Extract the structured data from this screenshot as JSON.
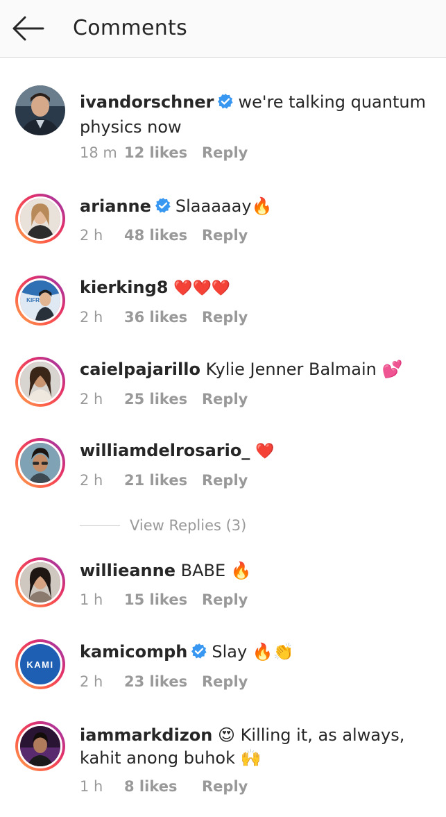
{
  "header": {
    "title": "Comments",
    "back_icon": "back-arrow-icon"
  },
  "comments": [
    {
      "username": "ivandorschner",
      "verified": true,
      "text": "we're talking quantum physics now",
      "time": "18 m",
      "likes": "12 likes",
      "reply": "Reply",
      "avatar_ring": false
    },
    {
      "username": "arianne",
      "verified": true,
      "text": "Slaaaaay🔥",
      "time": "2 h",
      "likes": "48 likes",
      "reply": "Reply",
      "avatar_ring": true
    },
    {
      "username": "kierking8",
      "verified": false,
      "text": "❤️❤️❤️",
      "time": "2 h",
      "likes": "36 likes",
      "reply": "Reply",
      "avatar_ring": true,
      "avatar_text": "KIFR"
    },
    {
      "username": "caielpajarillo",
      "verified": false,
      "text": "Kylie Jenner Balmain 💕",
      "time": "2 h",
      "likes": "25 likes",
      "reply": "Reply",
      "avatar_ring": true
    },
    {
      "username": "williamdelrosario_",
      "verified": false,
      "text": "❤️",
      "time": "2 h",
      "likes": "21 likes",
      "reply": "Reply",
      "avatar_ring": true
    },
    {
      "username": "willieanne",
      "verified": false,
      "text": "BABE 🔥",
      "time": "1 h",
      "likes": "15 likes",
      "reply": "Reply",
      "avatar_ring": true
    },
    {
      "username": "kamicomph",
      "verified": true,
      "text": "Slay 🔥👏",
      "time": "2 h",
      "likes": "23 likes",
      "reply": "Reply",
      "avatar_ring": true,
      "avatar_text": "KAMI"
    },
    {
      "username": "iammarkdizon",
      "verified": false,
      "text": "😍 Killing it, as always, kahit anong buhok 🙌",
      "time": "1 h",
      "likes": "8 likes",
      "reply": "Reply",
      "avatar_ring": true
    }
  ],
  "view_replies": {
    "label": "View Replies (3)"
  },
  "colors": {
    "verified_badge": "#3897f0",
    "ring_gradient": [
      "#8a3ab9",
      "#e1306c",
      "#fd5949",
      "#fbad50"
    ],
    "kami_blue": "#1e5fb4",
    "meta_gray": "#999999"
  }
}
